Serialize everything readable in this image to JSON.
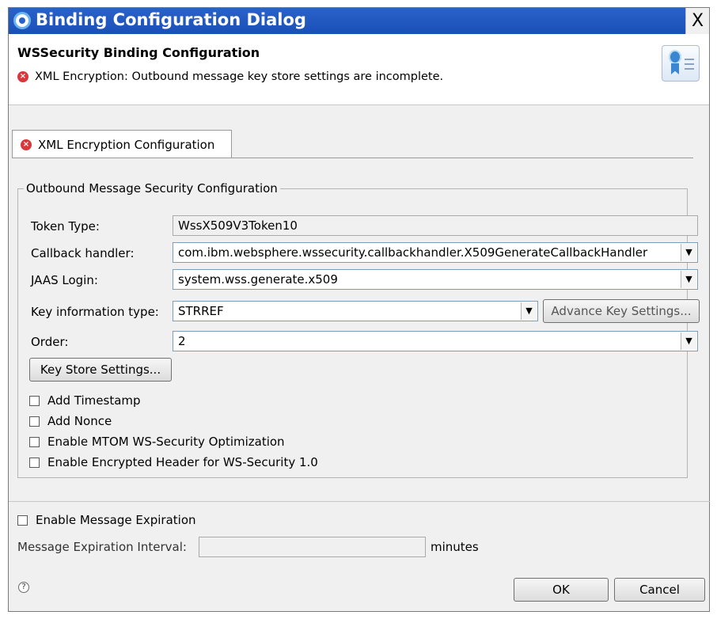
{
  "window": {
    "title": "Binding Configuration Dialog",
    "close_label": "X"
  },
  "header": {
    "title": "WSSecurity Binding Configuration",
    "error_message": "XML Encryption: Outbound message key store settings are incomplete."
  },
  "tab": {
    "label": "XML Encryption Configuration"
  },
  "group": {
    "legend": "Outbound Message Security Configuration",
    "token_type_label": "Token Type:",
    "token_type_value": "WssX509V3Token10",
    "callback_label": "Callback handler:",
    "callback_value": "com.ibm.websphere.wssecurity.callbackhandler.X509GenerateCallbackHandler",
    "jaas_label": "JAAS Login:",
    "jaas_value": "system.wss.generate.x509",
    "keyinfo_label": "Key information type:",
    "keyinfo_value": "STRREF",
    "advance_button": "Advance Key Settings...",
    "order_label": "Order:",
    "order_value": "2",
    "keystore_button": "Key Store Settings...",
    "checkboxes": [
      {
        "label": "Add Timestamp",
        "checked": false
      },
      {
        "label": "Add Nonce",
        "checked": false
      },
      {
        "label": "Enable MTOM WS-Security Optimization",
        "checked": false
      },
      {
        "label": "Enable Encrypted Header for WS-Security 1.0",
        "checked": false
      }
    ]
  },
  "expiration": {
    "enable_label": "Enable Message Expiration",
    "enable_checked": false,
    "interval_label": "Message Expiration Interval:",
    "interval_value": "",
    "unit_label": "minutes"
  },
  "footer": {
    "help_icon": "?",
    "ok_label": "OK",
    "cancel_label": "Cancel"
  },
  "colors": {
    "titlebar": "#1a4fb8",
    "error": "#d9373c",
    "dialog_bg": "#f0f0f0"
  }
}
